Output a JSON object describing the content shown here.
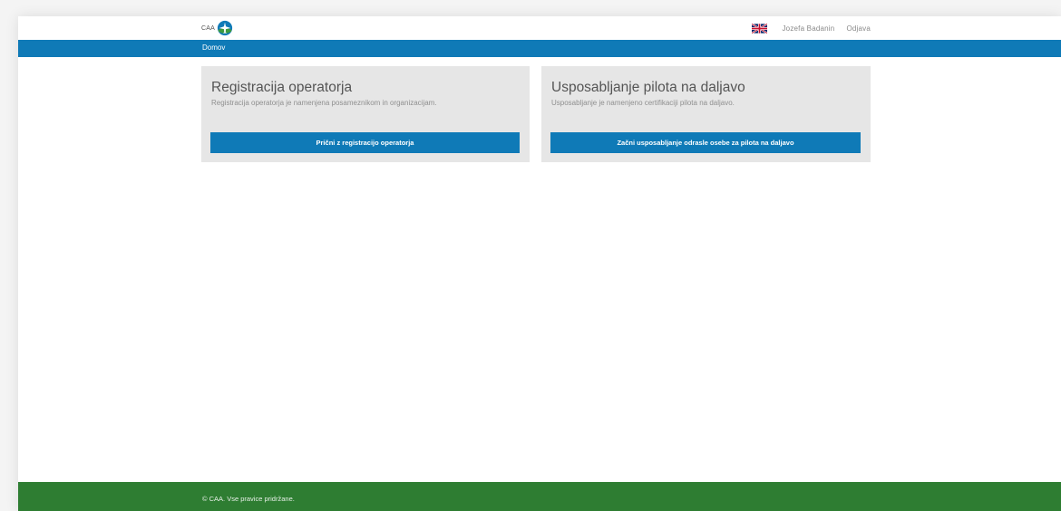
{
  "header": {
    "brand_text": "CAA",
    "logo_icon": "airplane-globe-logo-icon",
    "flag_icon": "uk-flag-icon",
    "user_name": "Jozefa Badanin",
    "logout_label": "Odjava"
  },
  "nav": {
    "home_label": "Domov",
    "color": "#0f7ab7"
  },
  "cards": [
    {
      "title": "Registracija operatorja",
      "description": "Registracija operatorja je namenjena posameznikom in organizacijam.",
      "button_label": "Prični z registracijo operatorja"
    },
    {
      "title": "Usposabljanje pilota na daljavo",
      "description": "Usposabljanje je namenjeno certifikaciji pilota na daljavo.",
      "button_label": "Začni usposabljanje odrasle osebe za pilota na daljavo"
    }
  ],
  "footer": {
    "copyright": "© CAA. Vse pravice pridržane.",
    "color": "#2e7d32"
  }
}
